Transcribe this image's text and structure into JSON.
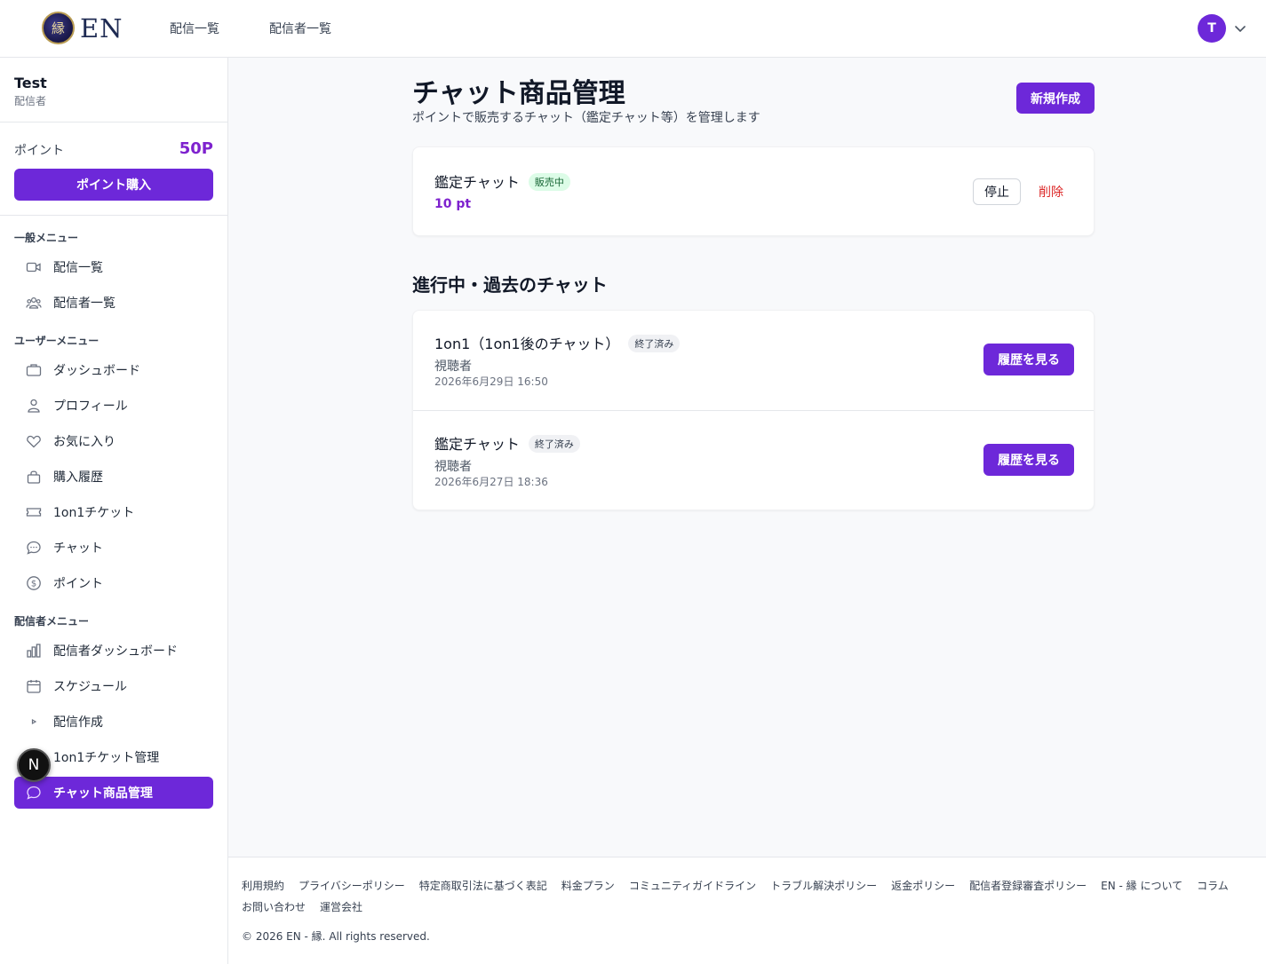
{
  "header": {
    "logo_mark": "縁",
    "logo_text": "EN",
    "nav": [
      "配信一覧",
      "配信者一覧"
    ],
    "avatar_initial": "T"
  },
  "sidebar": {
    "user_name": "Test",
    "user_role": "配信者",
    "points_label": "ポイント",
    "points_value": "50P",
    "buy_button": "ポイント購入",
    "sections": [
      {
        "title": "一般メニュー",
        "items": [
          {
            "label": "配信一覧",
            "icon": "video-icon"
          },
          {
            "label": "配信者一覧",
            "icon": "users-icon"
          }
        ]
      },
      {
        "title": "ユーザーメニュー",
        "items": [
          {
            "label": "ダッシュボード",
            "icon": "briefcase-icon"
          },
          {
            "label": "プロフィール",
            "icon": "user-icon"
          },
          {
            "label": "お気に入り",
            "icon": "heart-icon"
          },
          {
            "label": "購入履歴",
            "icon": "bag-icon"
          },
          {
            "label": "1on1チケット",
            "icon": "ticket-icon"
          },
          {
            "label": "チャット",
            "icon": "chat-icon"
          },
          {
            "label": "ポイント",
            "icon": "dollar-icon"
          }
        ]
      },
      {
        "title": "配信者メニュー",
        "items": [
          {
            "label": "配信者ダッシュボード",
            "icon": "bar-chart-icon"
          },
          {
            "label": "スケジュール",
            "icon": "calendar-icon"
          },
          {
            "label": "配信作成",
            "icon": "play-icon"
          },
          {
            "label": "1on1チケット管理",
            "icon": "ticket-icon"
          },
          {
            "label": "チャット商品管理",
            "icon": "chat-icon",
            "active": true
          }
        ]
      }
    ]
  },
  "main": {
    "title": "チャット商品管理",
    "subtitle": "ポイントで販売するチャット（鑑定チャット等）を管理します",
    "new_button": "新規作成",
    "product": {
      "name": "鑑定チャット",
      "status": "販売中",
      "price": "10 pt",
      "stop_label": "停止",
      "delete_label": "削除"
    },
    "chats_title": "進行中・過去のチャット",
    "chats": [
      {
        "title": "1on1（1on1後のチャット）",
        "status": "終了済み",
        "role": "視聴者",
        "date": "2026年6月29日 16:50",
        "button": "履歴を見る"
      },
      {
        "title": "鑑定チャット",
        "status": "終了済み",
        "role": "視聴者",
        "date": "2026年6月27日 18:36",
        "button": "履歴を見る"
      }
    ]
  },
  "footer": {
    "links": [
      "利用規約",
      "プライバシーポリシー",
      "特定商取引法に基づく表記",
      "料金プラン",
      "コミュニティガイドライン",
      "トラブル解決ポリシー",
      "返金ポリシー",
      "配信者登録審査ポリシー",
      "EN - 縁 について",
      "コラム",
      "お問い合わせ",
      "運営会社"
    ],
    "copyright": "© 2026 EN - 縁. All rights reserved."
  },
  "devtools_badge": "N",
  "colors": {
    "accent": "#6d28d9",
    "points": "#7e22ce",
    "danger": "#dc2626",
    "success_bg": "#dcfce7"
  }
}
